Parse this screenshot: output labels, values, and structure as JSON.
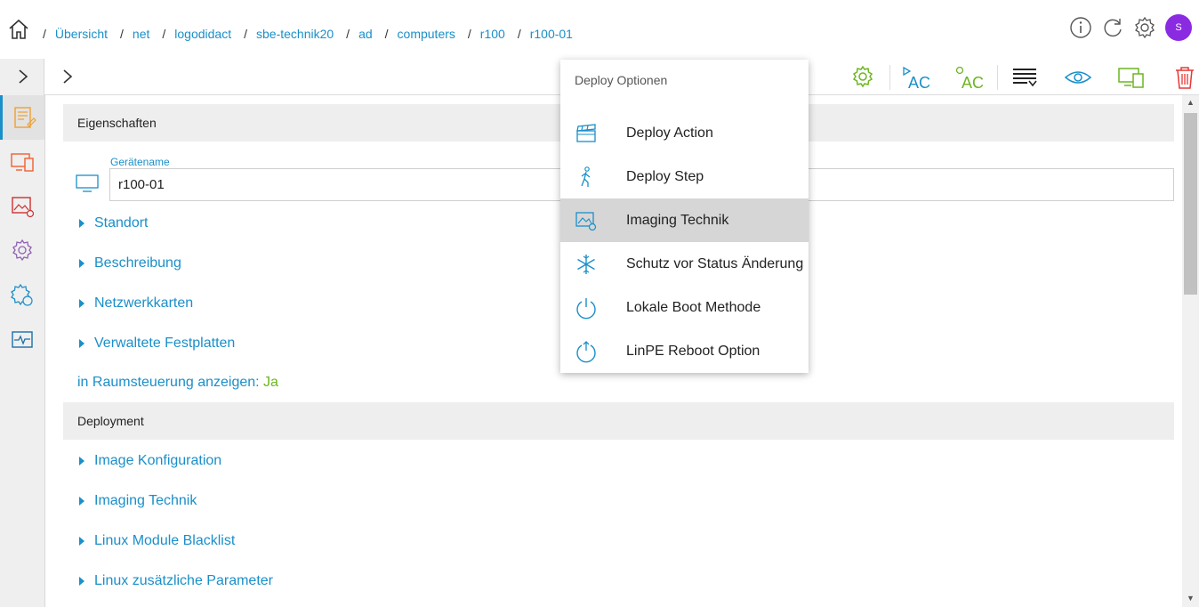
{
  "breadcrumb": {
    "items": [
      "Übersicht",
      "net",
      "logodidact",
      "sbe-technik20",
      "ad",
      "computers",
      "r100",
      "r100-01"
    ],
    "separator": "/"
  },
  "user": {
    "avatar_initial": "S"
  },
  "colors": {
    "accent": "#1a8fc9",
    "green": "#6cb520",
    "orange": "#f0a030",
    "red": "#e53935",
    "avatar": "#8a2be2"
  },
  "sections": {
    "properties": {
      "title": "Eigenschaften",
      "device_name_label": "Gerätename",
      "device_name_value": "r100-01",
      "expanders": [
        "Standort",
        "Beschreibung",
        "Netzwerkkarten",
        "Verwaltete Festplatten"
      ],
      "room_control_label": "in Raumsteuerung anzeigen:",
      "room_control_value": "Ja"
    },
    "deployment": {
      "title": "Deployment",
      "expanders": [
        "Image Konfiguration",
        "Imaging Technik",
        "Linux Module Blacklist",
        "Linux zusätzliche Parameter"
      ]
    }
  },
  "toolbar": {
    "text_icons": [
      "AC",
      "AC"
    ]
  },
  "menu": {
    "title": "Deploy Optionen",
    "items": [
      {
        "label": "Deploy Action",
        "icon": "clapperboard-icon"
      },
      {
        "label": "Deploy Step",
        "icon": "walking-person-icon"
      },
      {
        "label": "Imaging Technik",
        "icon": "image-settings-icon",
        "highlighted": true
      },
      {
        "label": "Schutz vor Status Änderung",
        "icon": "snowflake-icon"
      },
      {
        "label": "Lokale Boot Methode",
        "icon": "power-icon"
      },
      {
        "label": "LinPE Reboot Option",
        "icon": "power-reboot-icon"
      }
    ]
  }
}
